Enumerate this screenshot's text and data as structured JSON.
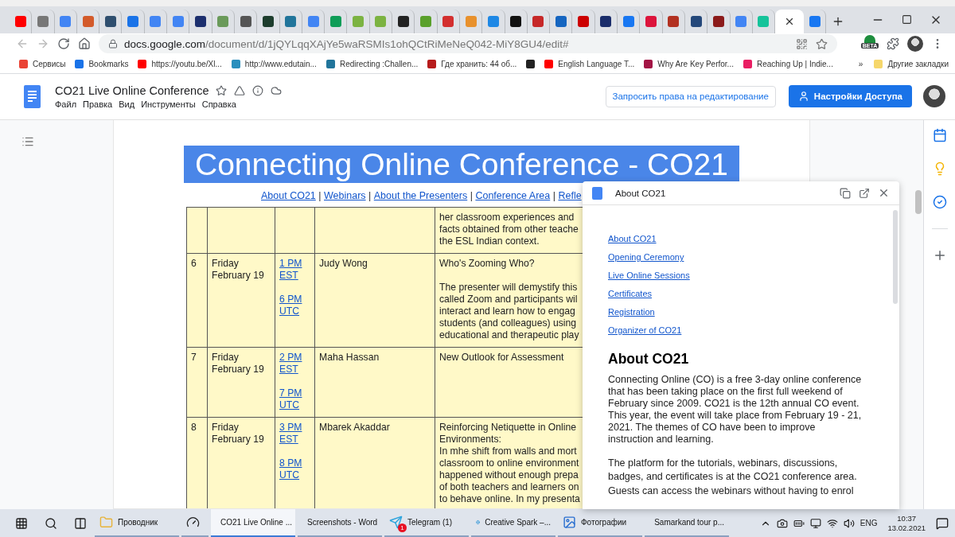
{
  "browser": {
    "tabs": [
      {
        "color": "#ff0000",
        "selected": false
      },
      {
        "color": "#777777",
        "selected": false
      },
      {
        "color": "#4285f4",
        "selected": false
      },
      {
        "color": "#d35b2b",
        "selected": false
      },
      {
        "color": "#2f4f6f",
        "selected": false
      },
      {
        "color": "#1a73e8",
        "selected": false
      },
      {
        "color": "#4285f4",
        "selected": false
      },
      {
        "color": "#4285f4",
        "selected": false
      },
      {
        "color": "#1c2f6e",
        "selected": false
      },
      {
        "color": "#6a9a5a",
        "selected": false
      },
      {
        "color": "#555555",
        "selected": false
      },
      {
        "color": "#1d3d2d",
        "selected": false
      },
      {
        "color": "#21759b",
        "selected": false
      },
      {
        "color": "#4285f4",
        "selected": false
      },
      {
        "color": "#0f9d58",
        "selected": false
      },
      {
        "color": "#7cb342",
        "selected": false
      },
      {
        "color": "#7cb342",
        "selected": false
      },
      {
        "color": "#222222",
        "selected": false
      },
      {
        "color": "#5aa02c",
        "selected": false
      },
      {
        "color": "#d32f2f",
        "selected": false
      },
      {
        "color": "#e8912d",
        "selected": false
      },
      {
        "color": "#1e88e5",
        "selected": false
      },
      {
        "color": "#111111",
        "selected": false
      },
      {
        "color": "#c62828",
        "selected": false
      },
      {
        "color": "#1565c0",
        "selected": false
      },
      {
        "color": "#cc0000",
        "selected": false
      },
      {
        "color": "#1a2d6b",
        "selected": false
      },
      {
        "color": "#1877f2",
        "selected": false
      },
      {
        "color": "#dc143c",
        "selected": false
      },
      {
        "color": "#b23121",
        "selected": false
      },
      {
        "color": "#24487a",
        "selected": false
      },
      {
        "color": "#8b1a1a",
        "selected": false
      },
      {
        "color": "#4285f4",
        "selected": false
      },
      {
        "color": "#15c39a",
        "selected": false
      },
      {
        "selected": true
      },
      {
        "color": "#1877f2",
        "selected": false
      }
    ],
    "url_host": "docs.google.com",
    "url_path": "/document/d/1jQYLqqXAjYe5waRSMIs1ohQCtRiMeNeQ042-MiY8GU4/edit#",
    "extension_badge": "BETA",
    "bookmarks": [
      {
        "label": "Сервисы",
        "color": "#ea4335"
      },
      {
        "label": "Bookmarks",
        "color": "#1a73e8"
      },
      {
        "label": "https://youtu.be/Xl...",
        "color": "#ff0000"
      },
      {
        "label": "http://www.edutain...",
        "color": "#2a8fbd"
      },
      {
        "label": "Redirecting :Challen...",
        "color": "#21759b"
      },
      {
        "label": "Где хранить: 44 об...",
        "color": "#b71c1c"
      },
      {
        "color": "#222222"
      },
      {
        "label": "English Language T...",
        "color": "#ff0000"
      },
      {
        "label": "Why Are Key Perfor...",
        "color": "#a31545"
      },
      {
        "label": "Reaching Up | Indie...",
        "color": "#e91e63"
      }
    ],
    "bookmarks_more": "»",
    "other_bookmarks": "Другие закладки"
  },
  "document_header": {
    "title": "CO21 Live Online Conference",
    "menu": [
      "Файл",
      "Правка",
      "Вид",
      "Инструменты",
      "Справка"
    ],
    "request_button": "Запросить права на редактирование",
    "share_button": "Настройки Доступа"
  },
  "document": {
    "banner": "Connecting Online Conference - CO21",
    "nav": [
      {
        "text": "About CO21",
        "kind": "link"
      },
      {
        "text": " | ",
        "kind": "separator"
      },
      {
        "text": "Webinars",
        "kind": "link"
      },
      {
        "text": " | ",
        "kind": "separator"
      },
      {
        "text": "About the Presenters",
        "kind": "link"
      },
      {
        "text": " | ",
        "kind": "separator"
      },
      {
        "text": "Conference Area",
        "kind": "link"
      },
      {
        "text": " | ",
        "kind": "separator"
      },
      {
        "text": "Refle",
        "kind": "link"
      }
    ],
    "rows": [
      {
        "times": [],
        "description": [
          [
            "her classroom experiences and",
            "facts obtained from other teache",
            "the ESL Indian context."
          ]
        ]
      },
      {
        "number": "6",
        "date": "Friday February 19",
        "times": [
          "1 PM EST",
          "6 PM UTC"
        ],
        "presenter": "Judy Wong",
        "description": [
          [
            "Who's Zooming Who?"
          ],
          [
            "The presenter will demystify this",
            "called Zoom and participants wil",
            "interact and learn how to engag",
            "students (and colleagues) using",
            "educational and therapeutic play"
          ]
        ]
      },
      {
        "number": "7",
        "date": "Friday February 19",
        "times": [
          "2 PM EST",
          "7 PM UTC"
        ],
        "presenter": "Maha Hassan",
        "description": [
          [
            "New Outlook for Assessment"
          ]
        ]
      },
      {
        "number": "8",
        "date": "Friday February 19",
        "times": [
          "3 PM EST",
          "8 PM UTC"
        ],
        "presenter": "Mbarek Akaddar",
        "description": [
          [
            "Reinforcing Netiquette in Online",
            "Environments:",
            "In mhe shift from walls and mort",
            "classroom to online environment",
            "happened without enough prepa",
            "of both teachers and learners on",
            "to behave online. In my presenta"
          ]
        ]
      }
    ]
  },
  "side_panel": {
    "title": "About CO21",
    "links": [
      "About CO21",
      "Opening Ceremony",
      "Live Online Sessions",
      "Certificates",
      "Registration",
      "Organizer of CO21"
    ],
    "heading": "About CO21",
    "paragraphs": [
      [
        "Connecting Online (CO) is a free 3-day online conference",
        "that has been taking place on the first full weekend of",
        "February since 2009.  CO21 is the 12th annual CO event.",
        "This year, the event will take place from February 19 - 21,",
        "2021. The themes of CO have been to improve",
        "instruction and  learning."
      ],
      [
        "The platform for the tutorials, webinars, discussions,",
        "badges, and certificates is at the CO21 conference area.",
        "Guests can access the webinars without having to enrol"
      ]
    ]
  },
  "taskbar": {
    "apps": [
      {
        "kind": "folder",
        "label": "Проводник",
        "selected": false
      },
      {
        "kind": "gauge",
        "selected": false
      },
      {
        "kind": "browser",
        "label": "CO21 Live Online ...",
        "selected": true
      },
      {
        "kind": "word",
        "label": "Screenshots - Word",
        "selected": false
      },
      {
        "kind": "telegram",
        "label": "Telegram (1)",
        "badge": "1",
        "selected": false
      },
      {
        "kind": "edge",
        "label": "Creative Spark –...",
        "selected": false
      },
      {
        "kind": "photos",
        "label": "Фотографии",
        "selected": false
      },
      {
        "kind": "slides",
        "label": "Samarkand tour p...",
        "selected": false
      }
    ],
    "language": "ENG",
    "time": "10:37",
    "date": "13.02.2021"
  }
}
